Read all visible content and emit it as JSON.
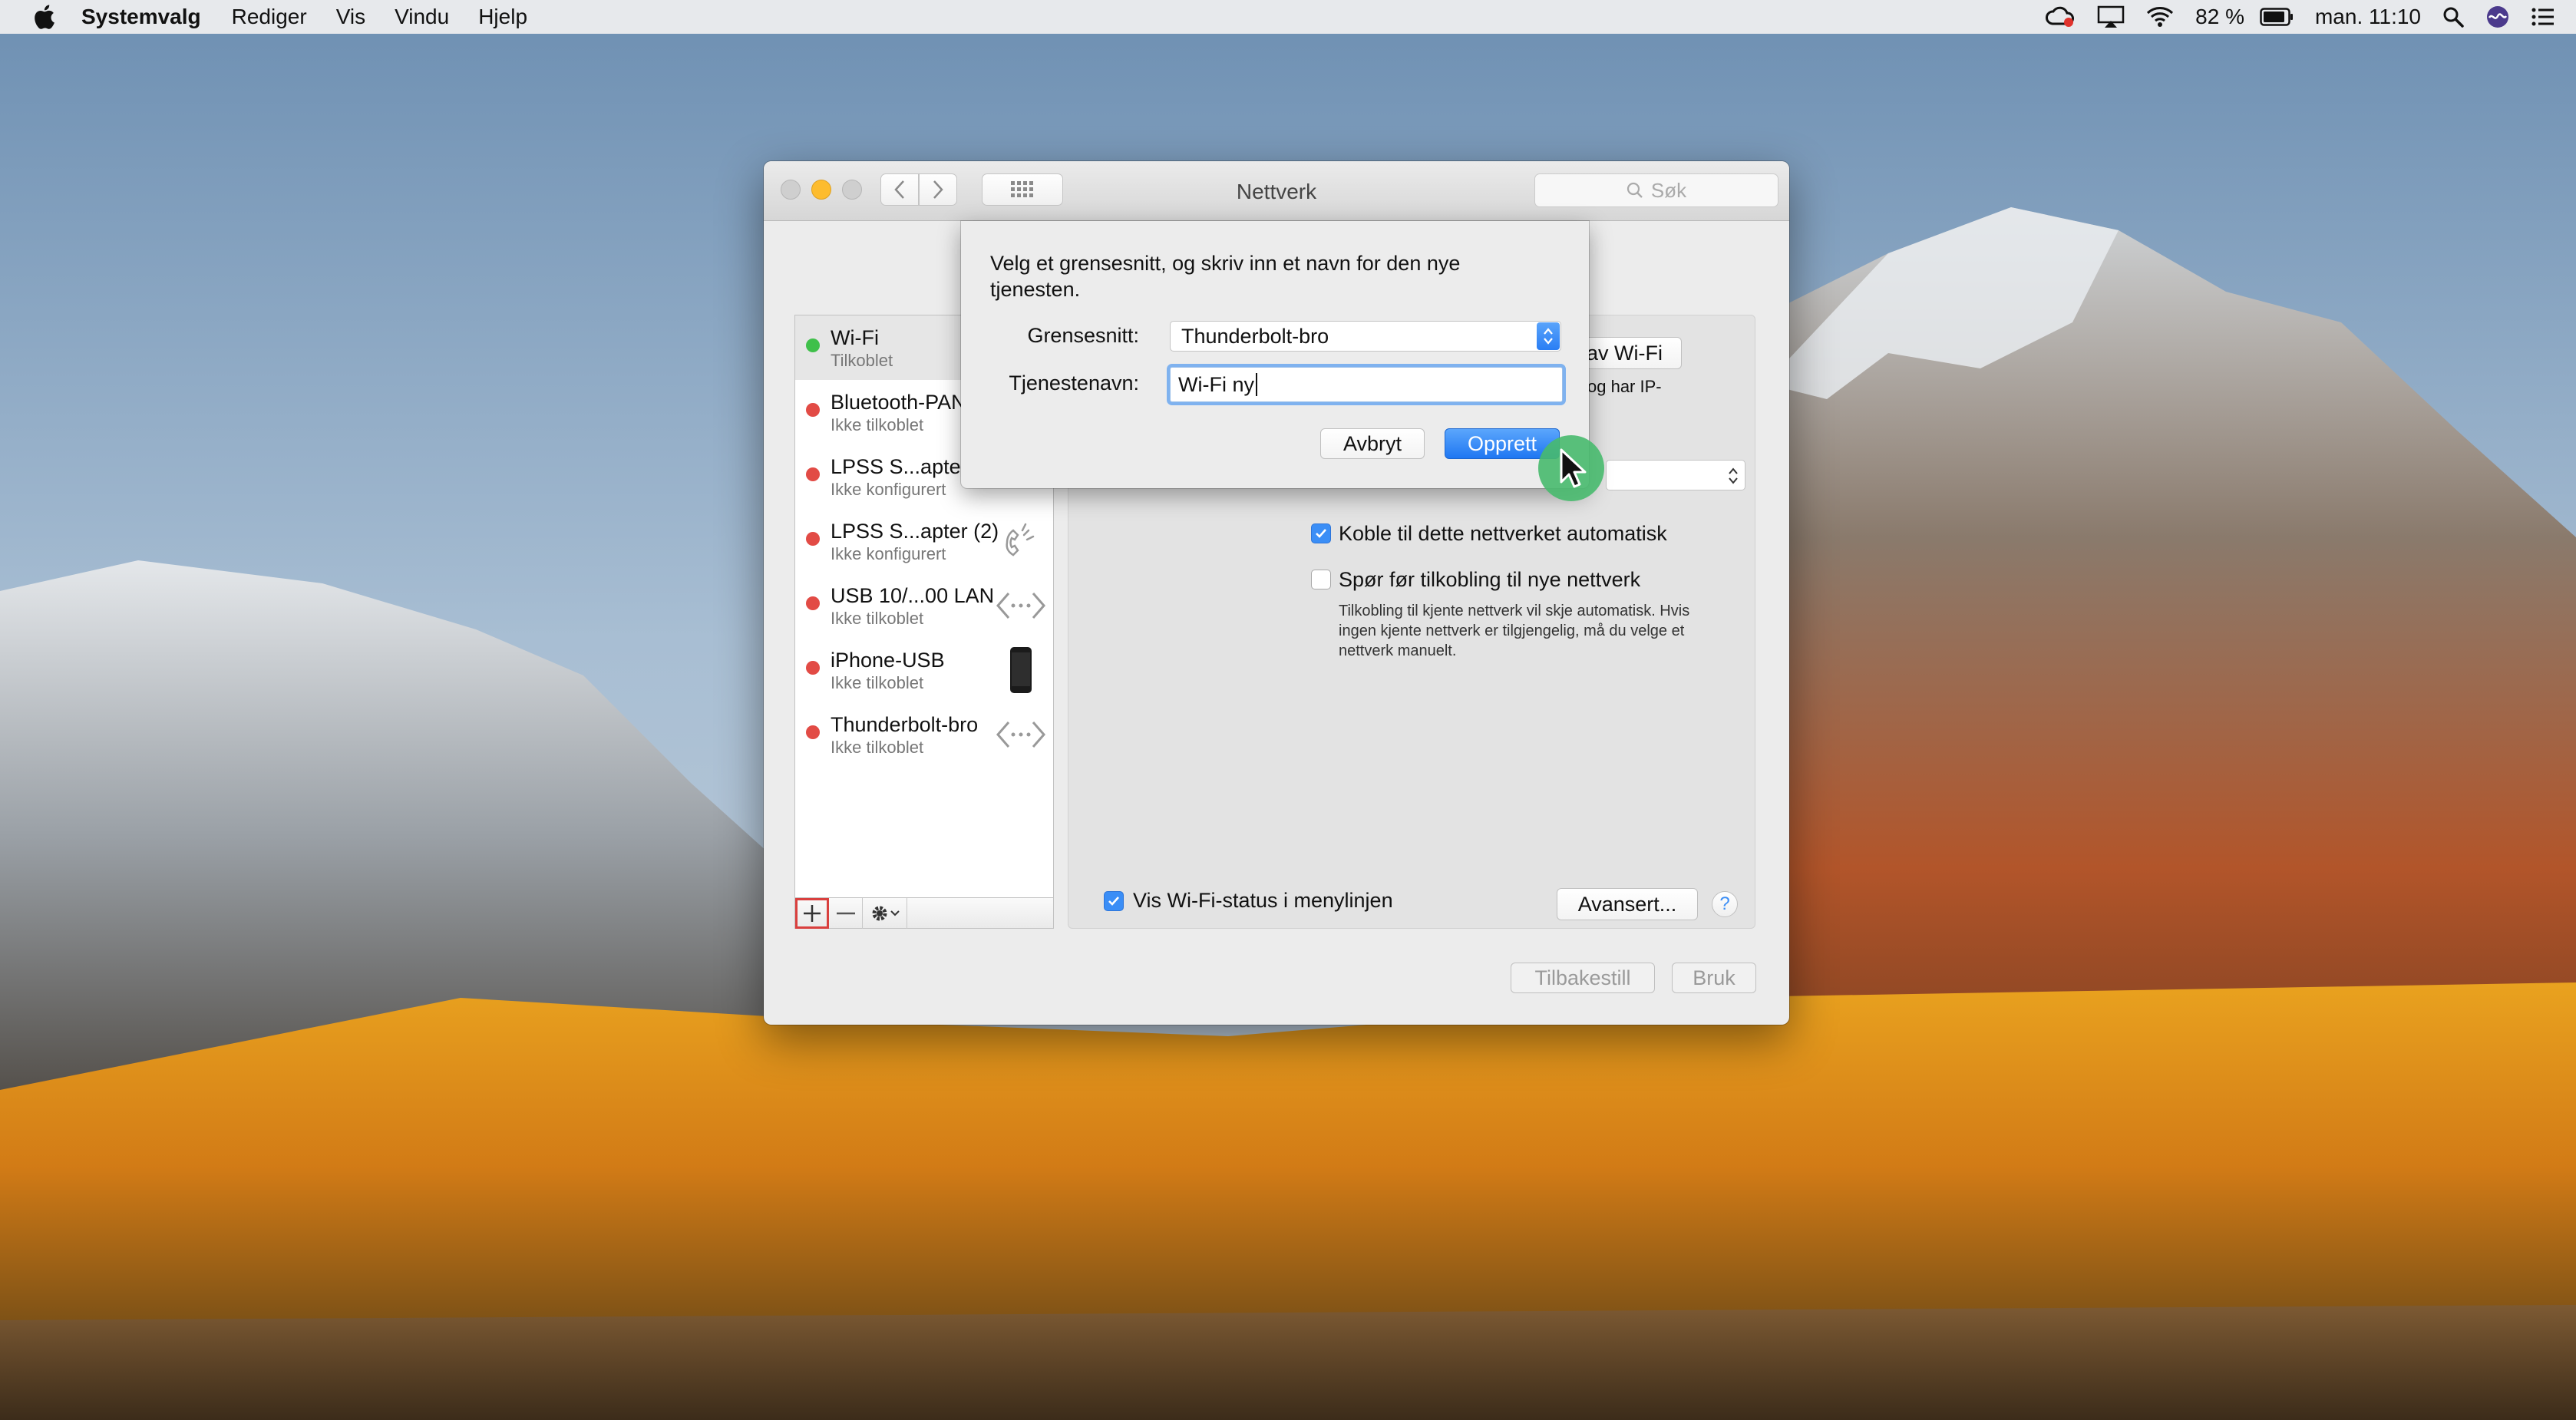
{
  "menubar": {
    "app_name": "Systemvalg",
    "items": [
      "Rediger",
      "Vis",
      "Vindu",
      "Hjelp"
    ],
    "battery_percent": "82 %",
    "clock": "man. 11:10"
  },
  "window": {
    "title": "Nettverk",
    "search_placeholder": "Søk"
  },
  "services": [
    {
      "name": "Wi-Fi",
      "status": "Tilkoblet",
      "dot_color": "#3fc04a",
      "icon": "wifi-icon"
    },
    {
      "name": "Bluetooth-PAN",
      "status": "Ikke tilkoblet",
      "dot_color": "#e24b45",
      "icon": "bluetooth-icon"
    },
    {
      "name": "LPSS S...apter",
      "status": "Ikke konfigurert",
      "dot_color": "#e24b45",
      "icon": "phone-handset-icon"
    },
    {
      "name": "LPSS S...apter (2)",
      "status": "Ikke konfigurert",
      "dot_color": "#e24b45",
      "icon": "phone-handset-icon"
    },
    {
      "name": "USB 10/...00 LAN",
      "status": "Ikke tilkoblet",
      "dot_color": "#e24b45",
      "icon": "ethernet-arrows-icon"
    },
    {
      "name": "iPhone-USB",
      "status": "Ikke tilkoblet",
      "dot_color": "#e24b45",
      "icon": "iphone-icon"
    },
    {
      "name": "Thunderbolt-bro",
      "status": "Ikke tilkoblet",
      "dot_color": "#e24b45",
      "icon": "ethernet-arrows-icon"
    }
  ],
  "pane": {
    "wifi_button_partial": "av Wi-Fi",
    "status_text_partial": "og har IP-",
    "auto_join_label": "Koble til dette nettverket automatisk",
    "auto_join_checked": true,
    "ask_label": "Spør før tilkobling til nye nettverk",
    "ask_checked": false,
    "ask_help": "Tilkobling til kjente nettverk vil skje automatisk. Hvis ingen kjente nettverk er tilgjengelig, må du velge et nettverk manuelt.",
    "show_status_label": "Vis Wi-Fi-status i menylinjen",
    "show_status_checked": true,
    "advanced_button": "Avansert...",
    "help_button": "?"
  },
  "footer": {
    "revert_button": "Tilbakestill",
    "apply_button": "Bruk"
  },
  "sheet": {
    "prompt": "Velg et grensesnitt, og skriv inn et navn for den nye tjenesten.",
    "interface_label": "Grensesnitt:",
    "interface_value": "Thunderbolt-bro",
    "service_name_label": "Tjenestenavn:",
    "service_name_value": "Wi-Fi ny",
    "cancel_button": "Avbryt",
    "create_button": "Opprett"
  },
  "colors": {
    "accent": "#2a7ef4",
    "connected": "#3fc04a",
    "disconnected": "#e24b45",
    "add_highlight": "#d9403e"
  }
}
